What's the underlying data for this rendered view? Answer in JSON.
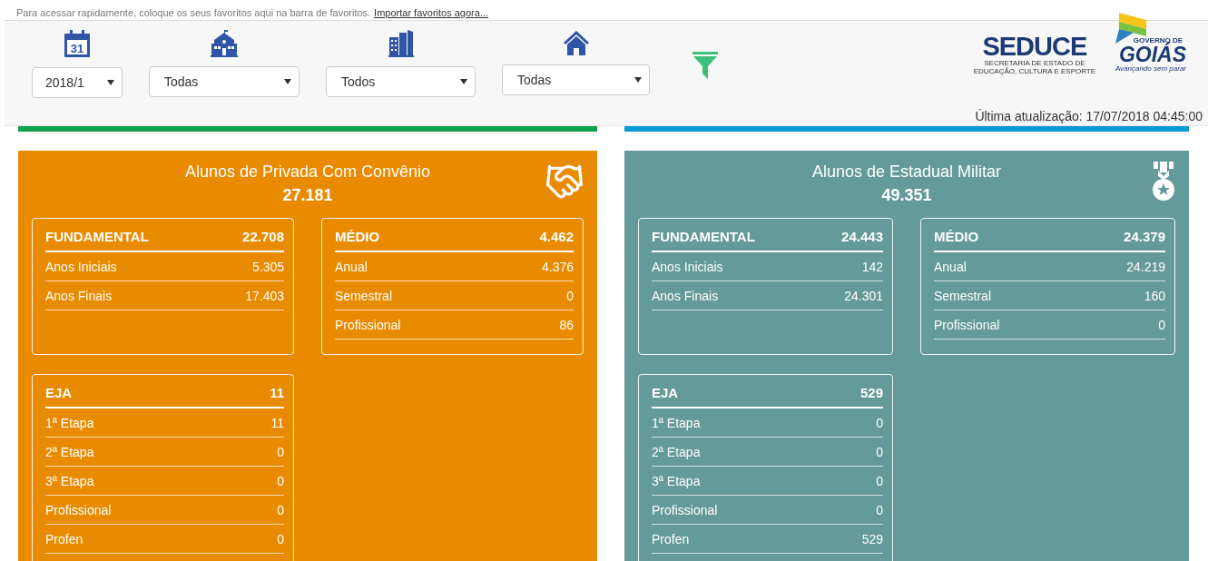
{
  "favorites_bar": {
    "text": "Para acessar rapidamente, coloque os seus favoritos aqui na barra de favoritos.",
    "link": "Importar favoritos agora..."
  },
  "filters": [
    {
      "calendar_day": "31",
      "value": "2018/1"
    },
    {
      "value": "Todas"
    },
    {
      "value": "Todos"
    },
    {
      "value": "Todas"
    }
  ],
  "logos": {
    "seduce": "SEDUCE",
    "seduce_subtitle": "SECRETARIA DE ESTADO DE EDUCAÇÃO, CULTURA E ESPORTE",
    "goias_small": "GOVERNO DE",
    "goias": "GOIÁS",
    "goias_slogan": "Avançando sem parar"
  },
  "last_update": "Última atualização: 17/07/2018 04:45:00",
  "panels": [
    {
      "color": "#e98b00",
      "title": "Alunos de Privada Com Convênio",
      "total": "27.181",
      "groups": [
        {
          "title": "FUNDAMENTAL",
          "total": "22.708",
          "rows": [
            {
              "label": "Anos Iniciais",
              "value": "5.305"
            },
            {
              "label": "Anos Finais",
              "value": "17.403"
            }
          ]
        },
        {
          "title": "MÉDIO",
          "total": "4.462",
          "rows": [
            {
              "label": "Anual",
              "value": "4.376"
            },
            {
              "label": "Semestral",
              "value": "0"
            },
            {
              "label": "Profissional",
              "value": "86"
            }
          ]
        },
        {
          "title": "EJA",
          "total": "11",
          "rows": [
            {
              "label": "1ª Etapa",
              "value": "11"
            },
            {
              "label": "2ª Etapa",
              "value": "0"
            },
            {
              "label": "3ª Etapa",
              "value": "0"
            },
            {
              "label": "Profissional",
              "value": "0"
            },
            {
              "label": "Profen",
              "value": "0"
            }
          ]
        }
      ]
    },
    {
      "color": "#659a9a",
      "title": "Alunos de Estadual Militar",
      "total": "49.351",
      "groups": [
        {
          "title": "FUNDAMENTAL",
          "total": "24.443",
          "rows": [
            {
              "label": "Anos Iniciais",
              "value": "142"
            },
            {
              "label": "Anos Finais",
              "value": "24.301"
            }
          ]
        },
        {
          "title": "MÉDIO",
          "total": "24.379",
          "rows": [
            {
              "label": "Anual",
              "value": "24.219"
            },
            {
              "label": "Semestral",
              "value": "160"
            },
            {
              "label": "Profissional",
              "value": "0"
            }
          ]
        },
        {
          "title": "EJA",
          "total": "529",
          "rows": [
            {
              "label": "1ª Etapa",
              "value": "0"
            },
            {
              "label": "2ª Etapa",
              "value": "0"
            },
            {
              "label": "3ª Etapa",
              "value": "0"
            },
            {
              "label": "Profissional",
              "value": "0"
            },
            {
              "label": "Profen",
              "value": "529"
            }
          ]
        }
      ]
    }
  ]
}
